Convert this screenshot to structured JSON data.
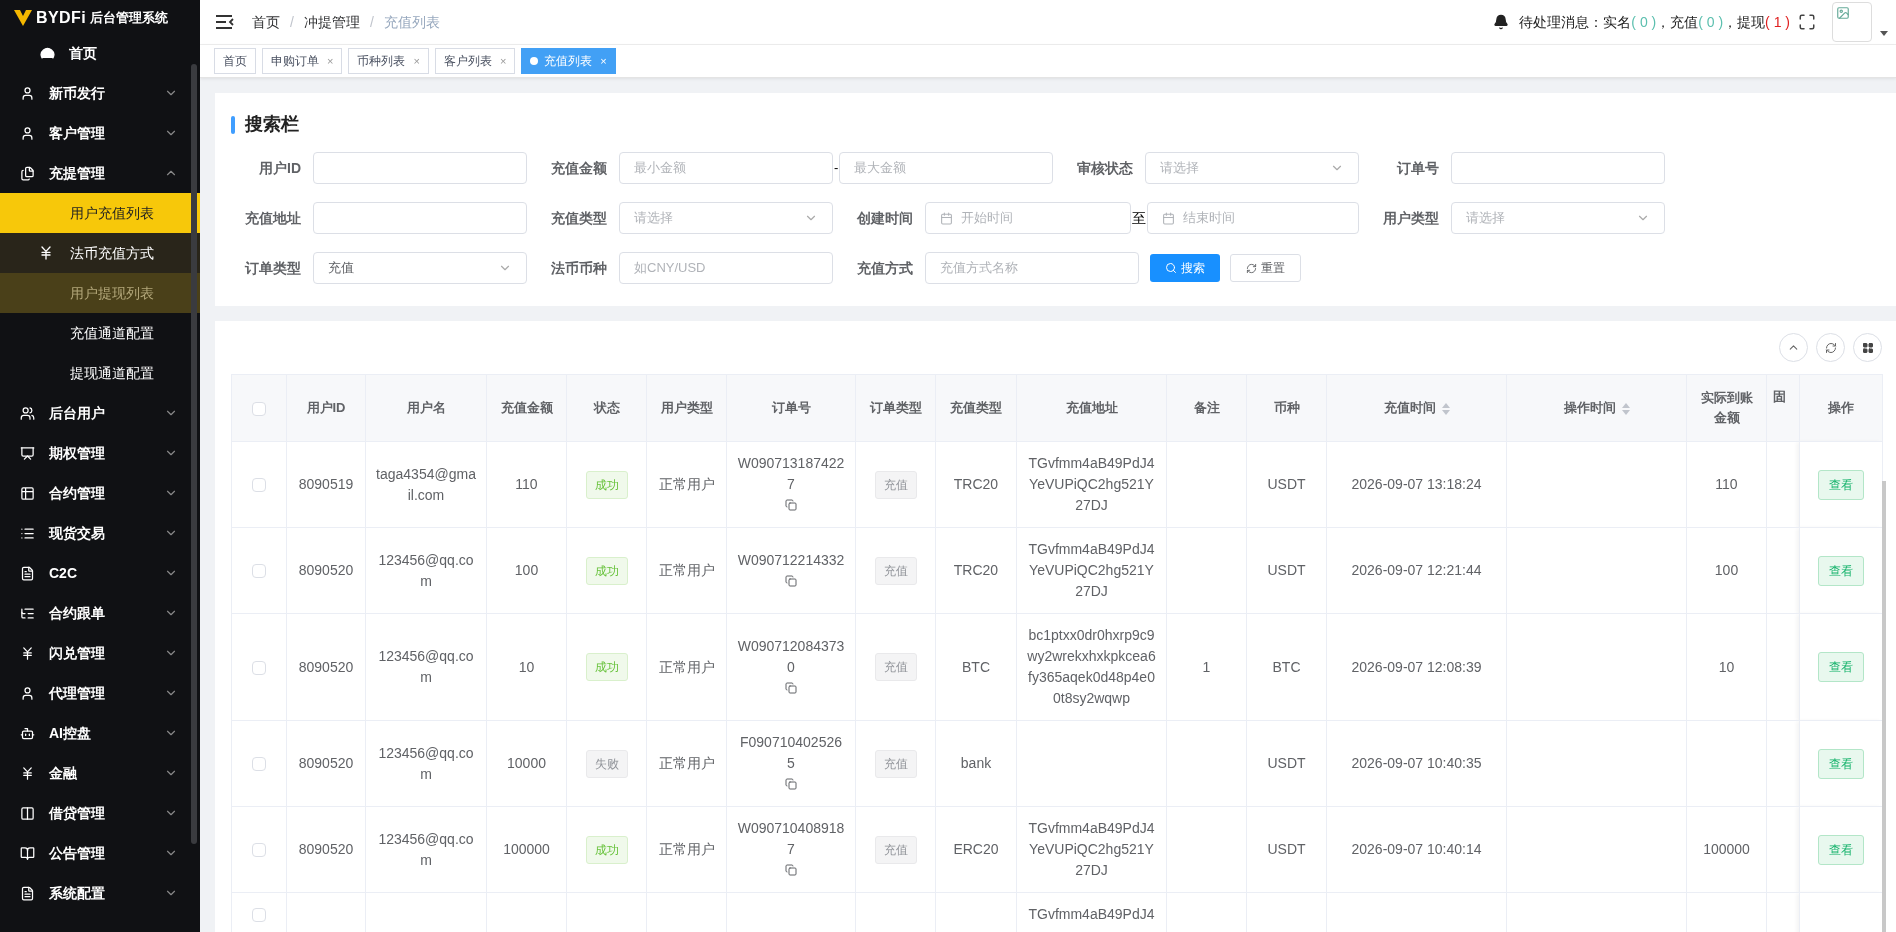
{
  "sidebar": {
    "logo": {
      "mark": "BYDFi",
      "title": "后台管理系统"
    },
    "items": [
      {
        "label": "首页"
      },
      {
        "label": "新币发行",
        "expanded": false
      },
      {
        "label": "客户管理",
        "expanded": false
      },
      {
        "label": "充提管理",
        "expanded": true,
        "children": [
          {
            "label": "用户充值列表",
            "selected": true
          },
          {
            "label": "法币充值方式",
            "selected": false,
            "focused": true,
            "has_icon": true
          },
          {
            "label": "用户提现列表",
            "selected": false,
            "hovered": true
          },
          {
            "label": "充值通道配置",
            "selected": false
          },
          {
            "label": "提现通道配置",
            "selected": false
          }
        ]
      },
      {
        "label": "后台用户",
        "expanded": false
      },
      {
        "label": "期权管理",
        "expanded": false
      },
      {
        "label": "合约管理",
        "expanded": false
      },
      {
        "label": "现货交易",
        "expanded": false
      },
      {
        "label": "C2C",
        "expanded": false
      },
      {
        "label": "合约跟单",
        "expanded": false
      },
      {
        "label": "闪兑管理",
        "expanded": false
      },
      {
        "label": "代理管理",
        "expanded": false
      },
      {
        "label": "AI控盘",
        "expanded": false
      },
      {
        "label": "金融",
        "expanded": false
      },
      {
        "label": "借贷管理",
        "expanded": false
      },
      {
        "label": "公告管理",
        "expanded": false
      },
      {
        "label": "系统配置",
        "expanded": false
      }
    ]
  },
  "breadcrumb": {
    "separator": "/",
    "items": [
      "首页",
      "冲提管理",
      "充值列表"
    ]
  },
  "notifications": {
    "label": "待处理消息：",
    "items": [
      {
        "name": "实名",
        "count": "( 0 )",
        "color": "#5bbfae",
        "sep": "，"
      },
      {
        "name": "充值",
        "count": "( 0 )",
        "color": "#5bbfae",
        "sep": "，"
      },
      {
        "name": "提现",
        "count": "( 1 )",
        "color": "#e02020"
      }
    ]
  },
  "tabs": [
    {
      "label": "首页",
      "selected": false
    },
    {
      "label": "申购订单",
      "selected": false,
      "close": "×"
    },
    {
      "label": "币种列表",
      "selected": false,
      "close": "×"
    },
    {
      "label": "客户列表",
      "selected": false,
      "close": "×"
    },
    {
      "label": "充值列表",
      "selected": true,
      "close": "×"
    }
  ],
  "search": {
    "title": "搜索栏",
    "rows": [
      [
        {
          "kind": "input",
          "label": "用户ID"
        },
        {
          "kind": "range",
          "label": "充值金额",
          "placeholder": "最小金额",
          "placeholder2": "最大金额",
          "sep": "-"
        },
        {
          "kind": "select",
          "label": "审核状态",
          "placeholder": "请选择"
        },
        {
          "kind": "input",
          "label": "订单号"
        }
      ],
      [
        {
          "kind": "input",
          "label": "充值地址"
        },
        {
          "kind": "select",
          "label": "充值类型",
          "placeholder": "请选择"
        },
        {
          "kind": "daterange",
          "label": "创建时间",
          "placeholder": "开始时间",
          "placeholder2": "结束时间",
          "sep": "至"
        },
        {
          "kind": "select",
          "label": "用户类型",
          "placeholder": "请选择"
        }
      ],
      [
        {
          "kind": "select",
          "label": "订单类型",
          "value": "充值"
        },
        {
          "kind": "input",
          "label": "法币币种",
          "placeholder": "如CNY/USD"
        },
        {
          "kind": "input",
          "label": "充值方式",
          "placeholder": "充值方式名称"
        }
      ]
    ],
    "actions": [
      {
        "kind": "primary",
        "label": "搜索"
      },
      {
        "kind": "plain",
        "label": "重置"
      }
    ]
  },
  "table": {
    "select_all": false,
    "columns": [
      {
        "label": "用户ID"
      },
      {
        "label": "用户名"
      },
      {
        "label": "充值金额"
      },
      {
        "label": "状态"
      },
      {
        "label": "用户类型"
      },
      {
        "label": "订单号"
      },
      {
        "label": "订单类型"
      },
      {
        "label": "充值类型"
      },
      {
        "label": "充值地址"
      },
      {
        "label": "备注"
      },
      {
        "label": "币种"
      },
      {
        "label": "充值时间",
        "sortable": true
      },
      {
        "label": "操作时间",
        "sortable": true
      },
      {
        "label": "实际到账金额"
      },
      {
        "label": "固"
      },
      {
        "label": "操作"
      }
    ],
    "rows": [
      {
        "checked": false,
        "user_id": "8090519",
        "username": "taga4354@gmail.com",
        "amount": "110",
        "status": {
          "label": "成功",
          "kind": "success"
        },
        "user_type": "正常用户",
        "order_no": "W0907131874227",
        "order_type": "充值",
        "charge_type": "TRC20",
        "address": "TGvfmm4aB49PdJ4YeVUPiQC2hg521Y27DJ",
        "coin": "USDT",
        "charge_time": "2026-09-07 13:18:24",
        "actual": "110",
        "action": "查看"
      },
      {
        "checked": false,
        "user_id": "8090520",
        "username": "123456@qq.com",
        "amount": "100",
        "status": {
          "label": "成功",
          "kind": "success"
        },
        "user_type": "正常用户",
        "order_no": "W090712214332",
        "order_type": "充值",
        "charge_type": "TRC20",
        "address": "TGvfmm4aB49PdJ4YeVUPiQC2hg521Y27DJ",
        "coin": "USDT",
        "charge_time": "2026-09-07 12:21:44",
        "actual": "100",
        "action": "查看"
      },
      {
        "checked": false,
        "user_id": "8090520",
        "username": "123456@qq.com",
        "amount": "10",
        "status": {
          "label": "成功",
          "kind": "success"
        },
        "user_type": "正常用户",
        "order_no": "W0907120843730",
        "order_type": "充值",
        "charge_type": "BTC",
        "address": "bc1ptxx0dr0hxrp9c9wy2wrekxhxkpkcea6fy365aqek0d48p4e00t8sy2wqwp",
        "remark": "1",
        "coin": "BTC",
        "charge_time": "2026-09-07 12:08:39",
        "actual": "10",
        "action": "查看"
      },
      {
        "checked": false,
        "user_id": "8090520",
        "username": "123456@qq.com",
        "amount": "10000",
        "status": {
          "label": "失败",
          "kind": "fail"
        },
        "user_type": "正常用户",
        "order_no": "F0907104025265",
        "order_type": "充值",
        "charge_type": "bank",
        "coin": "USDT",
        "charge_time": "2026-09-07 10:40:35",
        "action": "查看"
      },
      {
        "checked": false,
        "user_id": "8090520",
        "username": "123456@qq.com",
        "amount": "100000",
        "status": {
          "label": "成功",
          "kind": "success"
        },
        "user_type": "正常用户",
        "order_no": "W0907104089187",
        "order_type": "充值",
        "charge_type": "ERC20",
        "address": "TGvfmm4aB49PdJ4YeVUPiQC2hg521Y27DJ",
        "coin": "USDT",
        "charge_time": "2026-09-07 10:40:14",
        "actual": "100000",
        "action": "查看"
      },
      {
        "checked": false,
        "address": "TGvfmm4aB49PdJ4"
      }
    ]
  }
}
